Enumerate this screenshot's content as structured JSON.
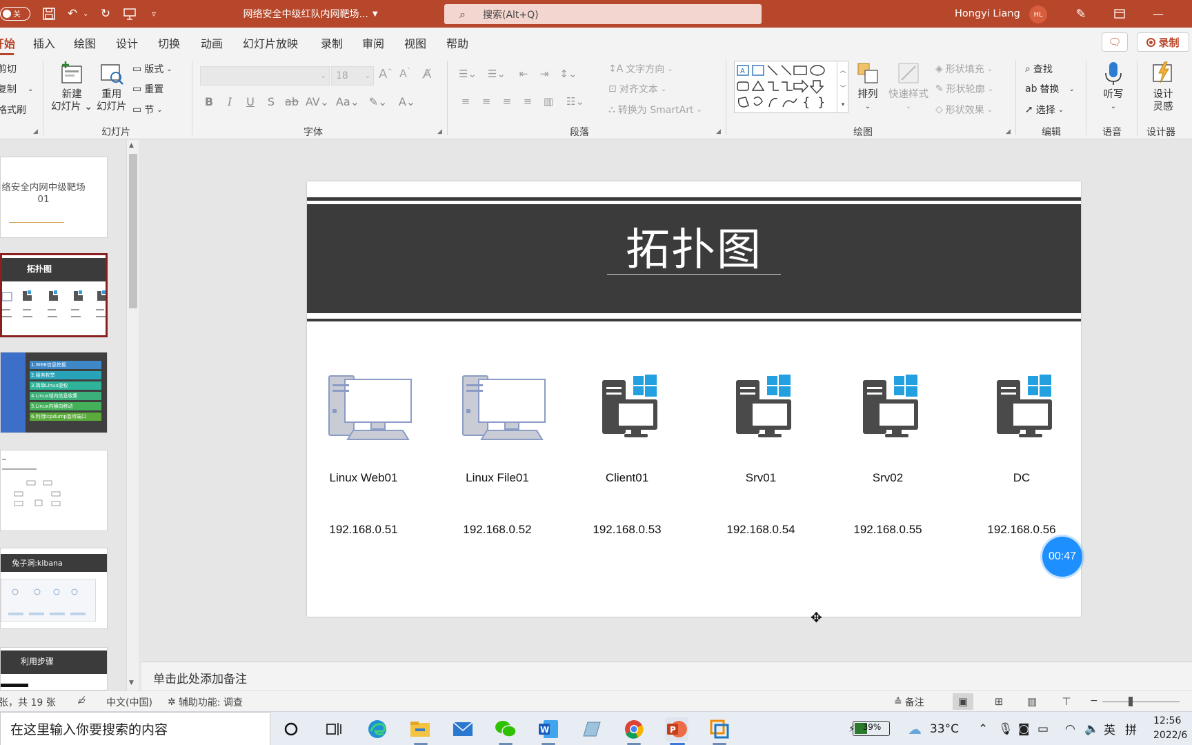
{
  "titlebar": {
    "autosave_label": "关",
    "doc_title": "网络安全中级红队内网靶场...",
    "search_placeholder": "搜索(Alt+Q)",
    "user_name": "Hongyi Liang",
    "avatar_initials": "HL",
    "accent": "#b7472a"
  },
  "tabs": [
    {
      "label": "开始",
      "active": true
    },
    {
      "label": "插入"
    },
    {
      "label": "绘图"
    },
    {
      "label": "设计"
    },
    {
      "label": "切换"
    },
    {
      "label": "动画"
    },
    {
      "label": "幻灯片放映"
    },
    {
      "label": "录制"
    },
    {
      "label": "审阅"
    },
    {
      "label": "视图"
    },
    {
      "label": "帮助"
    }
  ],
  "ribbon_actions": {
    "record_label": "录制"
  },
  "ribbon": {
    "clipboard": {
      "cut": "剪切",
      "copy": "复制",
      "format_painter": "格式刷"
    },
    "slides": {
      "new_slide": [
        "新建",
        "幻灯片"
      ],
      "reuse_slide": [
        "重用",
        "幻灯片"
      ],
      "layout": "版式",
      "reset": "重置",
      "section": "节",
      "group_label": "幻灯片"
    },
    "font": {
      "font_size": "18",
      "group_label": "字体"
    },
    "paragraph": {
      "text_direction": "文字方向",
      "align_text": "对齐文本",
      "convert_smartart": "转换为 SmartArt",
      "group_label": "段落"
    },
    "drawing": {
      "arrange": "排列",
      "quick_styles": "快速样式",
      "shape_fill": "形状填充",
      "shape_outline": "形状轮廓",
      "shape_effects": "形状效果",
      "group_label": "绘图"
    },
    "editing": {
      "find": "查找",
      "replace": "替换",
      "select": "选择",
      "group_label": "编辑"
    },
    "voice": {
      "dictate": "听写",
      "group_label": "语音"
    },
    "designer": {
      "design_ideas": [
        "设计",
        "灵感"
      ],
      "group_label": "设计器"
    }
  },
  "thumbnails": [
    {
      "title": "络安全内网中级靶场01"
    },
    {
      "title": "拓扑图"
    },
    {
      "items": [
        "1.WEB信息挖掘",
        "2.服务枚举",
        "3.简单Linux提权",
        "4.Linux域内信息收集",
        "5.Linux内横向移动",
        "6.利用tcpdump监听端口"
      ]
    },
    {
      "title": ""
    },
    {
      "title": "兔子洞:kibana"
    },
    {
      "title": "利用步骤"
    }
  ],
  "slide": {
    "title": "拓扑图",
    "nodes": [
      {
        "name": "Linux Web01",
        "ip": "192.168.0.51",
        "icon": "linux-pc-icon"
      },
      {
        "name": "Linux  File01",
        "ip": "192.168.0.52",
        "icon": "linux-pc-icon"
      },
      {
        "name": "Client01",
        "ip": "192.168.0.53",
        "icon": "windows-pc-icon"
      },
      {
        "name": "Srv01",
        "ip": "192.168.0.54",
        "icon": "windows-pc-icon"
      },
      {
        "name": "Srv02",
        "ip": "192.168.0.55",
        "icon": "windows-pc-icon"
      },
      {
        "name": "DC",
        "ip": "192.168.0.56",
        "icon": "windows-pc-icon"
      }
    ],
    "timer": "00:47"
  },
  "notes": {
    "placeholder": "单击此处添加备注"
  },
  "statusbar": {
    "slide_count": "张，共 19 张",
    "language": "中文(中国)",
    "accessibility": "辅助功能: 调查",
    "notes_label": "备注"
  },
  "taskbar": {
    "search_placeholder": "在这里输入你要搜索的内容",
    "battery": "39%",
    "temperature": "33°C",
    "ime_lang": "英",
    "ime_mode": "拼",
    "time": "12:56",
    "date": "2022/6"
  }
}
